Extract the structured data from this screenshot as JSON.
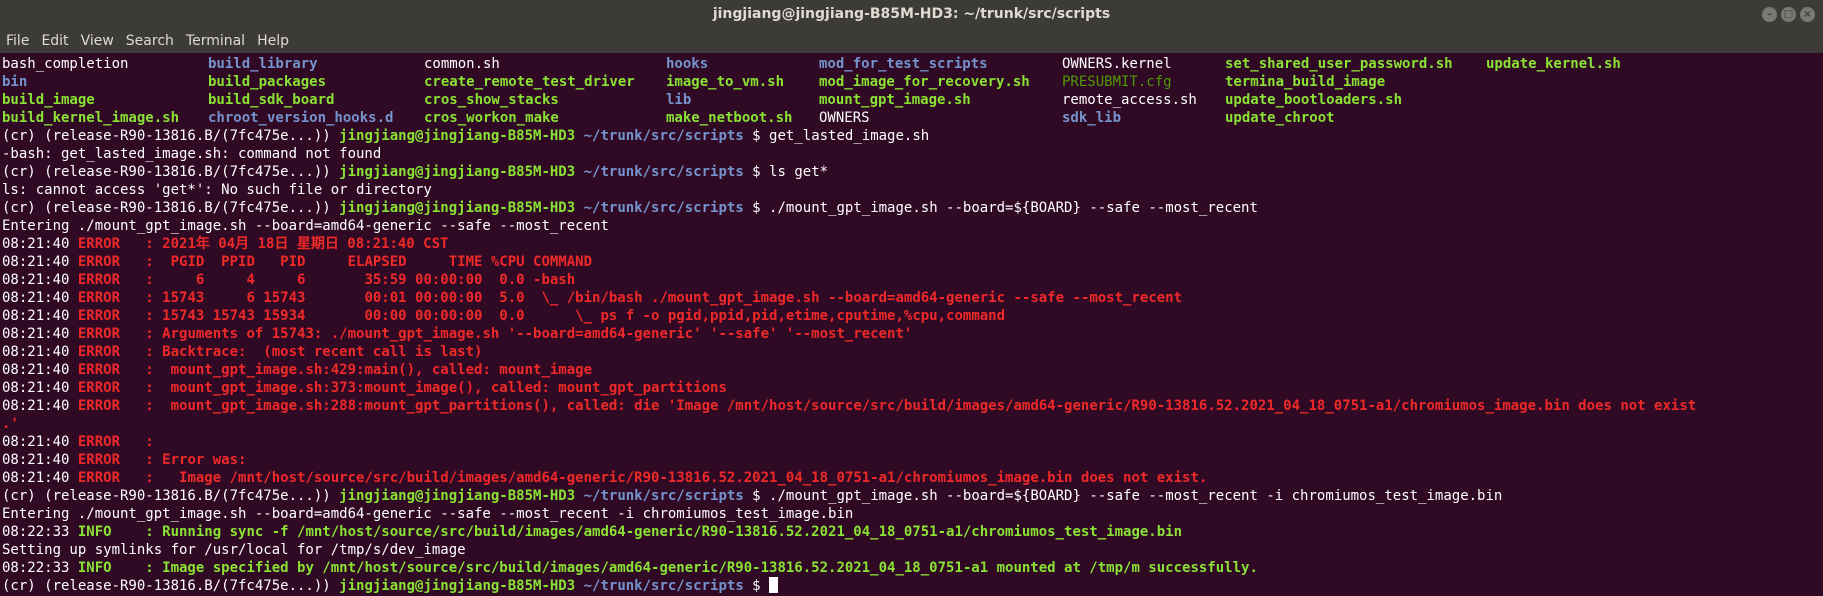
{
  "window": {
    "title": "jingjiang@jingjiang-B85M-HD3: ~/trunk/src/scripts",
    "buttons": [
      "–",
      "□",
      "×"
    ]
  },
  "menu": [
    "File",
    "Edit",
    "View",
    "Search",
    "Terminal",
    "Help"
  ],
  "prompt": {
    "prefix": "(cr) (release-R90-13816.B/(7fc475e...)) ",
    "user": "jingjiang@jingjiang-B85M-HD3",
    "path": "~/trunk/src/scripts",
    "dollar": " $ "
  },
  "listing": [
    [
      {
        "t": "bash_completion",
        "k": "file"
      },
      {
        "t": "build_library",
        "k": "dir"
      },
      {
        "t": "common.sh",
        "k": "file"
      },
      {
        "t": "hooks",
        "k": "dir"
      },
      {
        "t": "mod_for_test_scripts",
        "k": "dir"
      },
      {
        "t": "OWNERS.kernel",
        "k": "file"
      },
      {
        "t": "set_shared_user_password.sh",
        "k": "exe"
      },
      {
        "t": "update_kernel.sh",
        "k": "exe"
      }
    ],
    [
      {
        "t": "bin",
        "k": "dir"
      },
      {
        "t": "build_packages",
        "k": "exe"
      },
      {
        "t": "create_remote_test_driver",
        "k": "exe"
      },
      {
        "t": "image_to_vm.sh",
        "k": "exe"
      },
      {
        "t": "mod_image_for_recovery.sh",
        "k": "exe"
      },
      {
        "t": "PRESUBMIT.cfg",
        "k": "cfg"
      },
      {
        "t": "termina_build_image",
        "k": "exe"
      },
      {
        "t": "",
        "k": "file"
      }
    ],
    [
      {
        "t": "build_image",
        "k": "exe"
      },
      {
        "t": "build_sdk_board",
        "k": "exe"
      },
      {
        "t": "cros_show_stacks",
        "k": "exe"
      },
      {
        "t": "lib",
        "k": "dir"
      },
      {
        "t": "mount_gpt_image.sh",
        "k": "exe"
      },
      {
        "t": "remote_access.sh",
        "k": "file"
      },
      {
        "t": "update_bootloaders.sh",
        "k": "exe"
      },
      {
        "t": "",
        "k": "file"
      }
    ],
    [
      {
        "t": "build_kernel_image.sh",
        "k": "exe"
      },
      {
        "t": "chroot_version_hooks.d",
        "k": "dir"
      },
      {
        "t": "cros_workon_make",
        "k": "exe"
      },
      {
        "t": "make_netboot.sh",
        "k": "exe"
      },
      {
        "t": "OWNERS",
        "k": "file"
      },
      {
        "t": "sdk_lib",
        "k": "dir"
      },
      {
        "t": "update_chroot",
        "k": "exe"
      },
      {
        "t": "",
        "k": "file"
      }
    ]
  ],
  "lines": [
    {
      "type": "prompt",
      "cmd": "get_lasted_image.sh"
    },
    {
      "type": "plain",
      "text": "-bash: get_lasted_image.sh: command not found"
    },
    {
      "type": "prompt",
      "cmd": "ls get*"
    },
    {
      "type": "plain",
      "text": "ls: cannot access 'get*': No such file or directory"
    },
    {
      "type": "prompt",
      "cmd": "./mount_gpt_image.sh --board=${BOARD} --safe --most_recent"
    },
    {
      "type": "plain",
      "text": "Entering ./mount_gpt_image.sh --board=amd64-generic --safe --most_recent"
    },
    {
      "type": "log",
      "time": "08:21:40",
      "level": "ERROR",
      "cls": "err",
      "msg": "   : 2021年 04月 18日 星期日 08:21:40 CST"
    },
    {
      "type": "log",
      "time": "08:21:40",
      "level": "ERROR",
      "cls": "err",
      "msg": "   :  PGID  PPID   PID     ELAPSED     TIME %CPU COMMAND"
    },
    {
      "type": "log",
      "time": "08:21:40",
      "level": "ERROR",
      "cls": "err",
      "msg": "   :     6     4     6       35:59 00:00:00  0.0 -bash"
    },
    {
      "type": "log",
      "time": "08:21:40",
      "level": "ERROR",
      "cls": "err",
      "msg": "   : 15743     6 15743       00:01 00:00:00  5.0  \\_ /bin/bash ./mount_gpt_image.sh --board=amd64-generic --safe --most_recent"
    },
    {
      "type": "log",
      "time": "08:21:40",
      "level": "ERROR",
      "cls": "err",
      "msg": "   : 15743 15743 15934       00:00 00:00:00  0.0      \\_ ps f -o pgid,ppid,pid,etime,cputime,%cpu,command"
    },
    {
      "type": "log",
      "time": "08:21:40",
      "level": "ERROR",
      "cls": "err",
      "msg": "   : Arguments of 15743: ./mount_gpt_image.sh '--board=amd64-generic' '--safe' '--most_recent'"
    },
    {
      "type": "log",
      "time": "08:21:40",
      "level": "ERROR",
      "cls": "err",
      "msg": "   : Backtrace:  (most recent call is last)"
    },
    {
      "type": "log",
      "time": "08:21:40",
      "level": "ERROR",
      "cls": "err",
      "msg": "   :  mount_gpt_image.sh:429:main(), called: mount_image"
    },
    {
      "type": "log",
      "time": "08:21:40",
      "level": "ERROR",
      "cls": "err",
      "msg": "   :  mount_gpt_image.sh:373:mount_image(), called: mount_gpt_partitions"
    },
    {
      "type": "log",
      "time": "08:21:40",
      "level": "ERROR",
      "cls": "err",
      "msg": "   :  mount_gpt_image.sh:288:mount_gpt_partitions(), called: die 'Image /mnt/host/source/src/build/images/amd64-generic/R90-13816.52.2021_04_18_0751-a1/chromiumos_image.bin does not exist"
    },
    {
      "type": "wrap",
      "cls": "err",
      "text": ".'"
    },
    {
      "type": "log",
      "time": "08:21:40",
      "level": "ERROR",
      "cls": "err",
      "msg": "   :"
    },
    {
      "type": "log",
      "time": "08:21:40",
      "level": "ERROR",
      "cls": "err",
      "msg": "   : Error was:"
    },
    {
      "type": "log",
      "time": "08:21:40",
      "level": "ERROR",
      "cls": "err",
      "msg": "   :   Image /mnt/host/source/src/build/images/amd64-generic/R90-13816.52.2021_04_18_0751-a1/chromiumos_image.bin does not exist."
    },
    {
      "type": "prompt",
      "cmd": "./mount_gpt_image.sh --board=${BOARD} --safe --most_recent -i chromiumos_test_image.bin"
    },
    {
      "type": "plain",
      "text": "Entering ./mount_gpt_image.sh --board=amd64-generic --safe --most_recent -i chromiumos_test_image.bin"
    },
    {
      "type": "log",
      "time": "08:22:33",
      "level": "INFO",
      "cls": "info",
      "msg": "    : Running sync -f /mnt/host/source/src/build/images/amd64-generic/R90-13816.52.2021_04_18_0751-a1/chromiumos_test_image.bin"
    },
    {
      "type": "plain",
      "text": "Setting up symlinks for /usr/local for /tmp/s/dev_image"
    },
    {
      "type": "log",
      "time": "08:22:33",
      "level": "INFO",
      "cls": "info",
      "msg": "    : Image specified by /mnt/host/source/src/build/images/amd64-generic/R90-13816.52.2021_04_18_0751-a1 mounted at /tmp/m successfully."
    },
    {
      "type": "prompt",
      "cmd": "",
      "cursor": true
    }
  ]
}
